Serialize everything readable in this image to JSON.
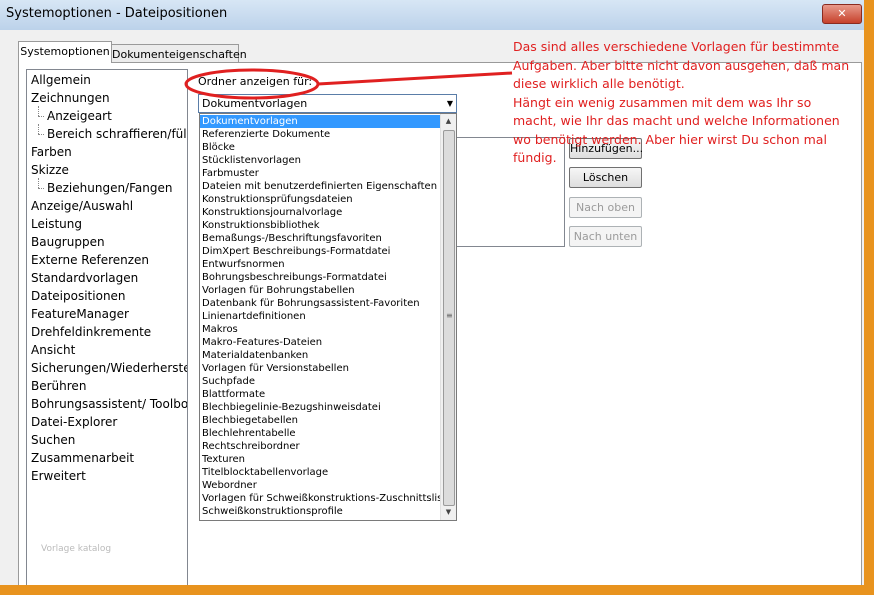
{
  "window": {
    "title": "Systemoptionen - Dateipositionen",
    "close_label": "✕"
  },
  "tabs": [
    {
      "label": "Systemoptionen",
      "active": true
    },
    {
      "label": "Dokumenteigenschaften",
      "active": false
    }
  ],
  "sidebar": {
    "items": [
      {
        "label": "Allgemein"
      },
      {
        "label": "Zeichnungen"
      },
      {
        "label": "Anzeigeart"
      },
      {
        "label": "Bereich schraffieren/füllen"
      },
      {
        "label": "Farben"
      },
      {
        "label": "Skizze"
      },
      {
        "label": "Beziehungen/Fangen"
      },
      {
        "label": "Anzeige/Auswahl"
      },
      {
        "label": "Leistung"
      },
      {
        "label": "Baugruppen"
      },
      {
        "label": "Externe Referenzen"
      },
      {
        "label": "Standardvorlagen"
      },
      {
        "label": "Dateipositionen"
      },
      {
        "label": "FeatureManager"
      },
      {
        "label": "Drehfeldinkremente"
      },
      {
        "label": "Ansicht"
      },
      {
        "label": "Sicherungen/Wiederherstellen"
      },
      {
        "label": "Berühren"
      },
      {
        "label": "Bohrungsassistent/ Toolbox"
      },
      {
        "label": "Datei-Explorer"
      },
      {
        "label": "Suchen"
      },
      {
        "label": "Zusammenarbeit"
      },
      {
        "label": "Erweitert"
      }
    ],
    "watermark": "Vorlage katalog"
  },
  "main": {
    "folder_label": "Ordner anzeigen für:",
    "combo_value": "Dokumentvorlagen",
    "buttons": {
      "add": "Hinzufügen...",
      "delete": "Löschen",
      "up": "Nach oben",
      "down": "Nach unten"
    }
  },
  "dropdown": {
    "items": [
      "Dokumentvorlagen",
      "Referenzierte Dokumente",
      "Blöcke",
      "Stücklistenvorlagen",
      "Farbmuster",
      "Dateien mit benutzerdefinierten Eigenschaften",
      "Konstruktionsprüfungsdateien",
      "Konstruktionsjournalvorlage",
      "Konstruktionsbibliothek",
      "Bemaßungs-/Beschriftungsfavoriten",
      "DimXpert Beschreibungs-Formatdatei",
      "Entwurfsnormen",
      "Bohrungsbeschreibungs-Formatdatei",
      "Vorlagen für Bohrungstabellen",
      "Datenbank für Bohrungsassistent-Favoriten",
      "Linienartdefinitionen",
      "Makros",
      "Makro-Features-Dateien",
      "Materialdatenbanken",
      "Vorlagen für Versionstabellen",
      "Suchpfade",
      "Blattformate",
      "Blechbiegelinie-Bezugshinweisdatei",
      "Blechbiegetabellen",
      "Blechlehrentabelle",
      "Rechtschreibordner",
      "Texturen",
      "Titelblocktabellenvorlage",
      "Webordner",
      "Vorlagen für Schweißkonstruktions-Zuschnittsliste",
      "Schweißkonstruktionsprofile"
    ],
    "selected_index": 0
  },
  "annotation": {
    "lines": [
      "Das sind alles verschiedene Vorlagen für bestimmte",
      "Aufgaben. Aber bitte nicht davon ausgehen, daß man",
      "diese wirklich alle benötigt.",
      "Hängt ein wenig zusammen mit dem was Ihr so",
      "macht, wie Ihr das macht und welche Informationen",
      "wo benötigt werden. Aber hier wirst Du schon mal",
      "fündig."
    ],
    "color": "#e02020"
  },
  "colors": {
    "frame": "#e8931e",
    "selection": "#3399ff"
  }
}
